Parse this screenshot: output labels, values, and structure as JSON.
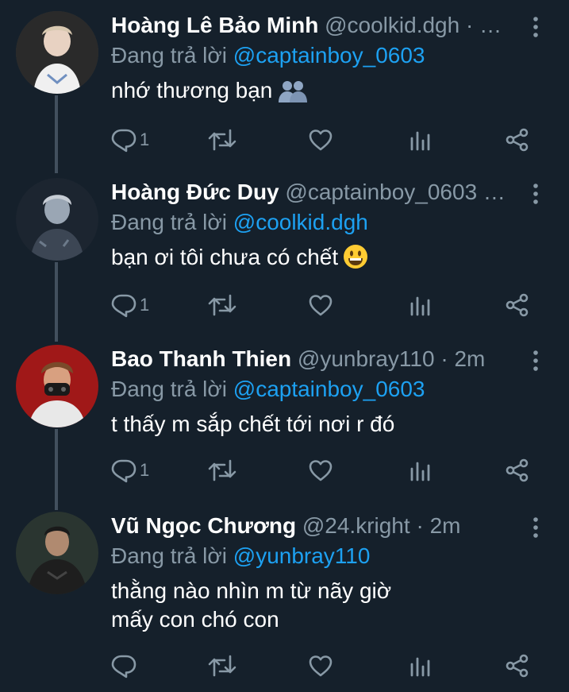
{
  "tweets": [
    {
      "name": "Hoàng Lê Bảo Minh",
      "handle": "@coolkid.dgh",
      "dot": "·",
      "time": "…",
      "reply_label": "Đang trả lời",
      "reply_mention": "@captainboy_0603",
      "text": "nhớ thương bạn",
      "emoji": "people-hugging-emoji",
      "reply_count": "1"
    },
    {
      "name": "Hoàng Đức Duy",
      "handle": "@captainboy_0603",
      "dot": "",
      "time": "…",
      "reply_label": "Đang trả lời",
      "reply_mention": "@coolkid.dgh",
      "text": "bạn ơi tôi chưa có chết",
      "emoji": "grinning-face-emoji",
      "reply_count": "1"
    },
    {
      "name": "Bao Thanh Thien",
      "handle": "@yunbray110",
      "dot": "·",
      "time": "2m",
      "reply_label": "Đang trả lời",
      "reply_mention": "@captainboy_0603",
      "text": "t thấy m sắp chết tới nơi r đó",
      "emoji": "",
      "reply_count": "1"
    },
    {
      "name": "Vũ Ngọc Chương",
      "handle": "@24.kright",
      "dot": "·",
      "time": "2m",
      "reply_label": "Đang trả lời",
      "reply_mention": "@yunbray110",
      "text": "thằng nào nhìn m từ nãy giờ mấy con chó con",
      "emoji": "",
      "reply_count": ""
    }
  ],
  "icons": {
    "reply": "reply-icon",
    "retweet": "retweet-icon",
    "like": "heart-icon",
    "analytics": "analytics-icon",
    "share": "share-icon",
    "more": "more-vertical-icon"
  },
  "colors": {
    "background": "#15202b",
    "secondary_text": "#8899a6",
    "accent": "#1da1f2",
    "thread_line": "#42505e"
  }
}
